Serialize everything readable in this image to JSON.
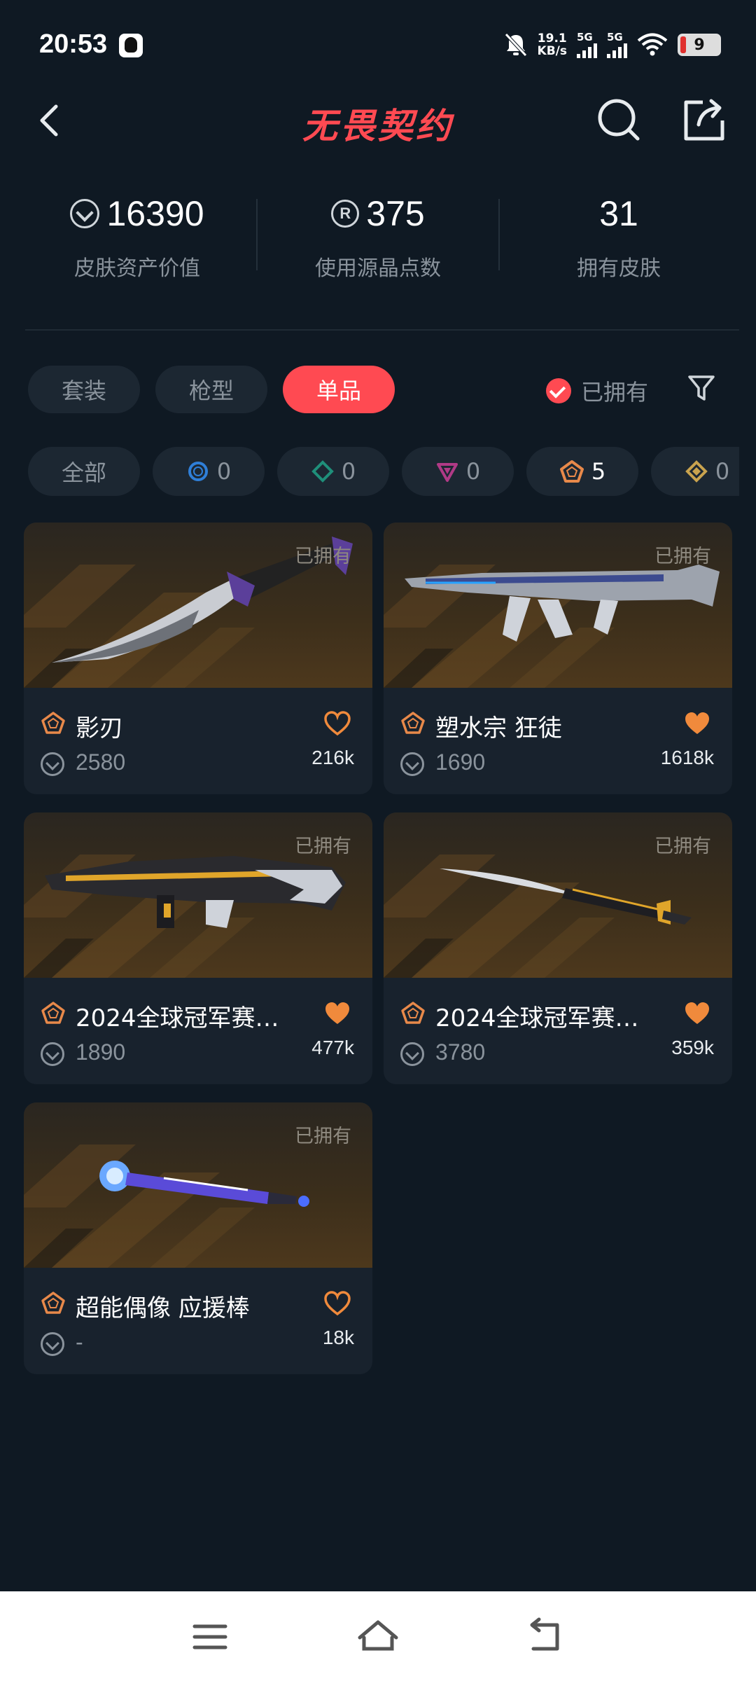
{
  "status_bar": {
    "time": "20:53",
    "net_speed_value": "19.1",
    "net_speed_unit": "KB/s",
    "sim1": "5G",
    "sim2": "5G",
    "battery": "9"
  },
  "header": {
    "title": "无畏契约",
    "icons": [
      "back-icon",
      "search-icon",
      "share-icon"
    ]
  },
  "stats": [
    {
      "value": "16390",
      "label": "皮肤资产价值",
      "icon": "vp-coin-icon"
    },
    {
      "value": "375",
      "label": "使用源晶点数",
      "icon": "radianite-icon"
    },
    {
      "value": "31",
      "label": "拥有皮肤"
    }
  ],
  "tabs": [
    "套装",
    "枪型",
    "单品"
  ],
  "active_tab": "单品",
  "owned_filter_label": "已拥有",
  "rarity_chips": [
    {
      "label": "全部"
    },
    {
      "count": "0",
      "icon": "select-tier-icon",
      "color": "#2f7fd8"
    },
    {
      "count": "0",
      "icon": "deluxe-tier-icon",
      "color": "#1f8f7a"
    },
    {
      "count": "0",
      "icon": "premium-tier-icon",
      "color": "#b03a86"
    },
    {
      "count": "5",
      "icon": "exclusive-tier-icon",
      "color": "#e8894a"
    },
    {
      "count": "0",
      "icon": "ultra-tier-icon",
      "color": "#c9a34e"
    }
  ],
  "cards": [
    {
      "owned": "已拥有",
      "name": "影刃",
      "price": "2580",
      "likes": "216k",
      "liked": false
    },
    {
      "owned": "已拥有",
      "name": "塑水宗 狂徒",
      "price": "1690",
      "likes": "1618k",
      "liked": true
    },
    {
      "owned": "已拥有",
      "name": "2024全球冠军赛…",
      "price": "1890",
      "likes": "477k",
      "liked": true
    },
    {
      "owned": "已拥有",
      "name": "2024全球冠军赛…",
      "price": "3780",
      "likes": "359k",
      "liked": true
    },
    {
      "owned": "已拥有",
      "name": "超能偶像 应援棒",
      "price": "-",
      "likes": "18k",
      "liked": false
    }
  ],
  "colors": {
    "accent": "#ff4a52",
    "background": "#0f1923",
    "card": "#18222d",
    "tier": "#e8894a"
  }
}
